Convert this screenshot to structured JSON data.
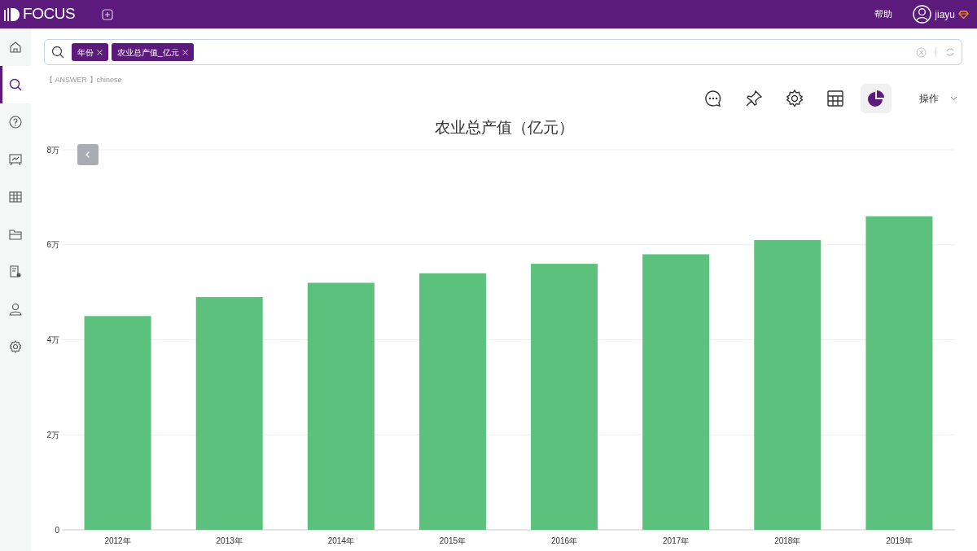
{
  "header": {
    "logo": "FOCUS",
    "help": "帮助",
    "user": "jiayu"
  },
  "sidebar": {
    "items": [
      {
        "selected": false
      },
      {
        "selected": true
      },
      {
        "selected": false
      },
      {
        "selected": false
      },
      {
        "selected": false
      },
      {
        "selected": false
      },
      {
        "selected": false
      },
      {
        "selected": false
      },
      {
        "selected": false
      }
    ]
  },
  "search": {
    "tokens": [
      "年份",
      "农业总产值_亿元"
    ]
  },
  "answer_label": "【 ANSWER 】chinese",
  "toolbar": {
    "buttons": [
      {
        "selected": false
      },
      {
        "selected": false
      },
      {
        "selected": false
      },
      {
        "selected": false
      },
      {
        "selected": true
      }
    ],
    "menu": "操作"
  },
  "chart": {
    "chart_data": {
      "type": "bar",
      "title": "农业总产值（亿元）",
      "categories": [
        "2012年",
        "2013年",
        "2014年",
        "2015年",
        "2016年",
        "2017年",
        "2018年",
        "2019年"
      ],
      "series": [
        {
          "color": "#5cc17d",
          "values": [
            4.5,
            4.9,
            5.2,
            5.4,
            5.6,
            5.8,
            6.1,
            6.6
          ]
        }
      ],
      "ylim": [
        0,
        8
      ],
      "grid": true,
      "yticks": [
        {
          "value": 0,
          "label": "0"
        },
        {
          "value": 2,
          "label": "2万"
        },
        {
          "value": 4,
          "label": "4万"
        },
        {
          "value": 6,
          "label": "6万"
        },
        {
          "value": 8,
          "label": "8万"
        }
      ]
    }
  }
}
